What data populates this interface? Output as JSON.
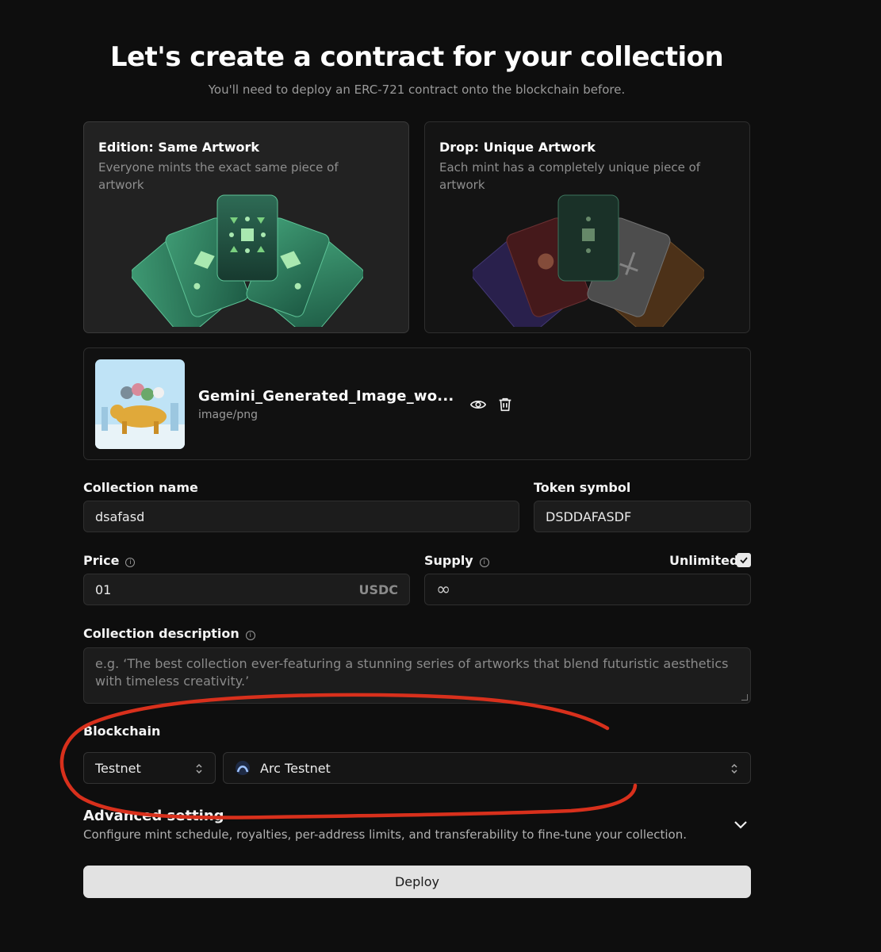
{
  "header": {
    "title": "Let's create a contract for your collection",
    "subtitle": "You'll need to deploy an ERC-721 contract onto the blockchain before."
  },
  "types": [
    {
      "title": "Edition: Same Artwork",
      "description": "Everyone mints the exact same piece of artwork",
      "selected": true
    },
    {
      "title": "Drop: Unique Artwork",
      "description": "Each mint has a completely unique piece of artwork",
      "selected": false
    }
  ],
  "upload": {
    "file_name": "Gemini_Generated_Image_wo...",
    "file_type": "image/png",
    "preview_icon": "eye-icon",
    "delete_icon": "trash-icon"
  },
  "form": {
    "collection_name": {
      "label": "Collection name",
      "value": "dsafasd"
    },
    "token_symbol": {
      "label": "Token symbol",
      "value": "DSDDAFASDF"
    },
    "price": {
      "label": "Price",
      "value": "01",
      "suffix": "USDC"
    },
    "supply": {
      "label": "Supply",
      "value": "∞",
      "unlimited_label": "Unlimited",
      "unlimited_checked": true
    },
    "description": {
      "label": "Collection description",
      "placeholder": "e.g. ‘The best collection ever-featuring a stunning series of artworks that blend futuristic aesthetics with timeless creativity.’"
    },
    "blockchain": {
      "label": "Blockchain",
      "network_type": "Testnet",
      "network": "Arc Testnet"
    }
  },
  "advanced": {
    "title": "Advanced setting",
    "description": "Configure mint schedule, royalties, per-address limits, and transferability to fine-tune your collection."
  },
  "actions": {
    "deploy_label": "Deploy"
  },
  "colors": {
    "background": "#0e0e0e",
    "annotation": "#d8301c",
    "deploy_button": "#e2e2e2"
  }
}
